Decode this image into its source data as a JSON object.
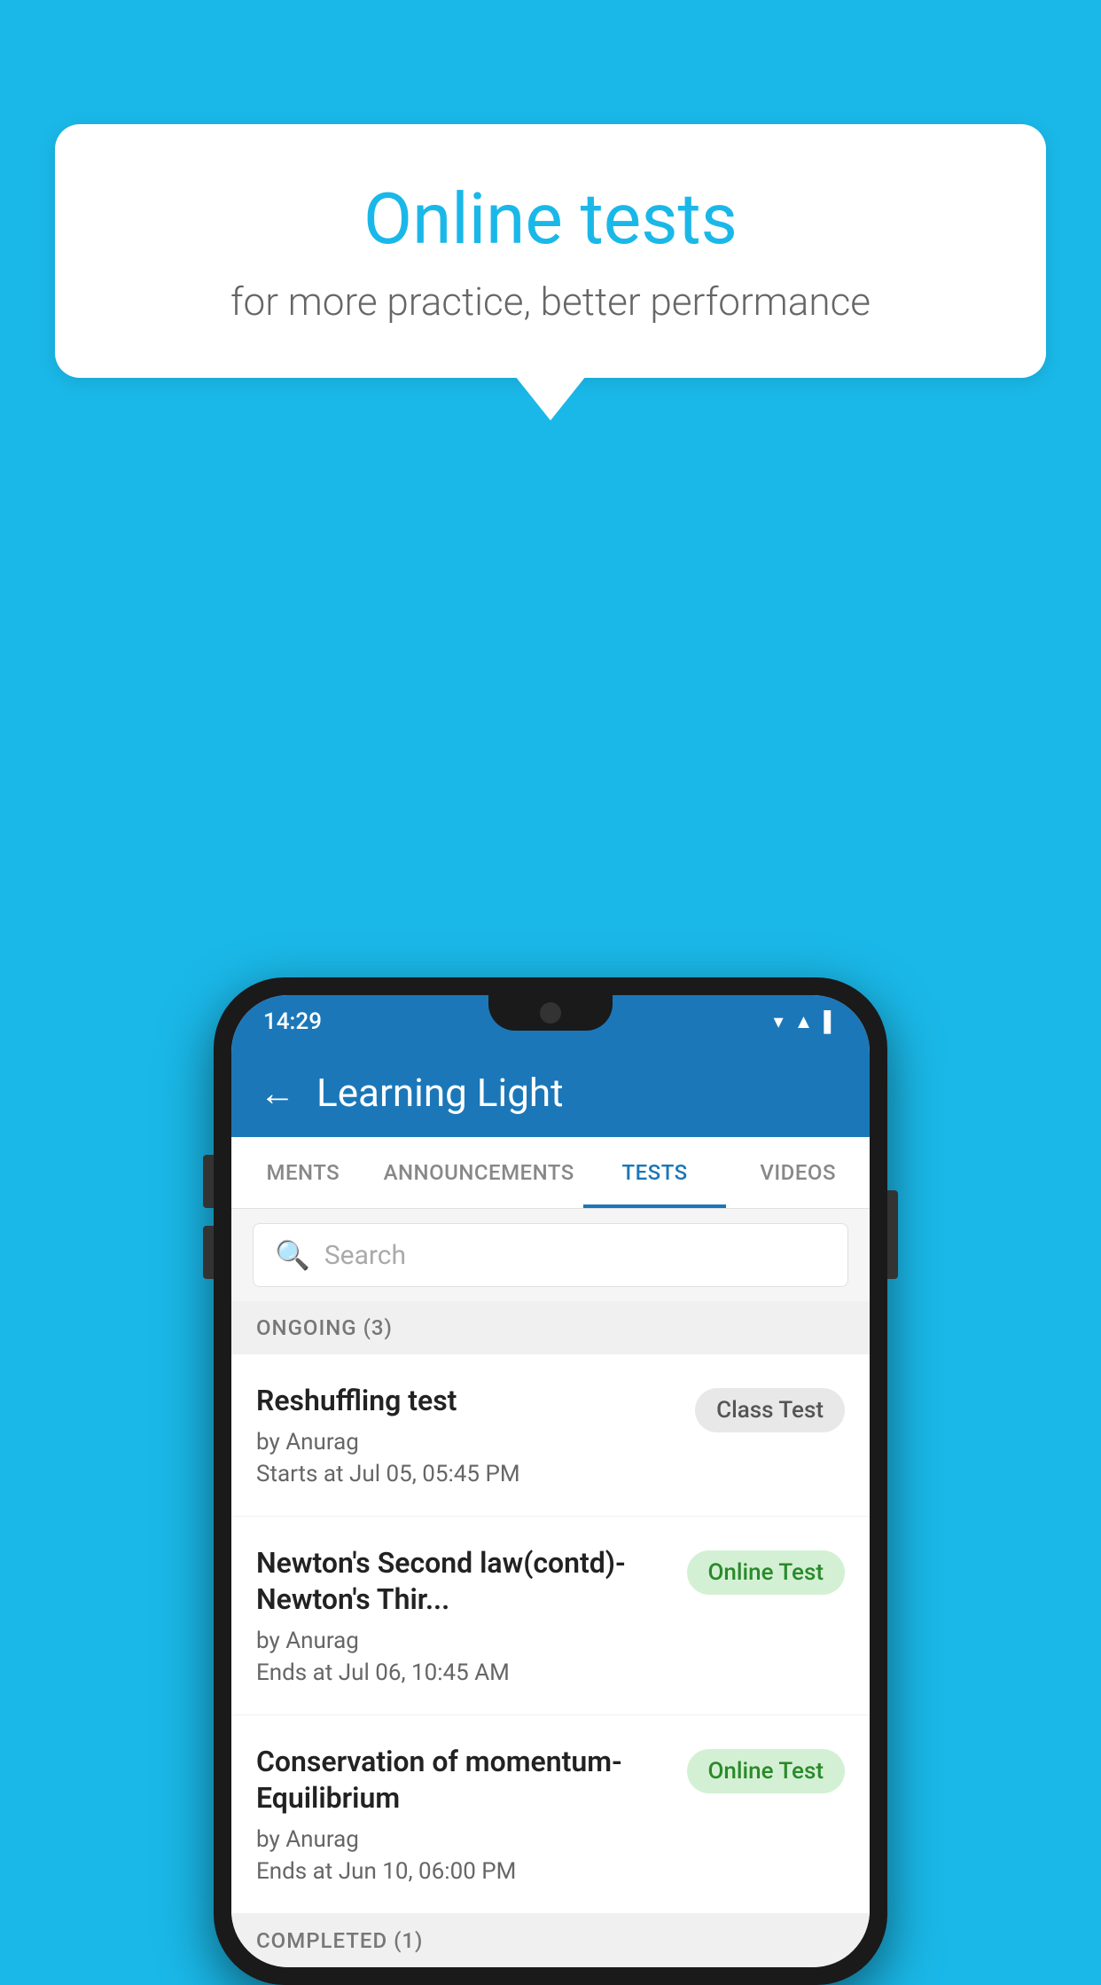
{
  "background": {
    "color": "#1ab8e8"
  },
  "speech_bubble": {
    "title": "Online tests",
    "subtitle": "for more practice, better performance"
  },
  "phone": {
    "status_bar": {
      "time": "14:29",
      "icons": [
        "wifi",
        "signal",
        "battery"
      ]
    },
    "header": {
      "back_label": "←",
      "title": "Learning Light"
    },
    "tabs": [
      {
        "label": "MENTS",
        "active": false
      },
      {
        "label": "ANNOUNCEMENTS",
        "active": false
      },
      {
        "label": "TESTS",
        "active": true
      },
      {
        "label": "VIDEOS",
        "active": false
      }
    ],
    "search": {
      "placeholder": "Search"
    },
    "sections": [
      {
        "title": "ONGOING (3)",
        "tests": [
          {
            "name": "Reshuffling test",
            "author": "by Anurag",
            "time_label": "Starts at",
            "time": "Jul 05, 05:45 PM",
            "badge": "Class Test",
            "badge_type": "class"
          },
          {
            "name": "Newton's Second law(contd)-Newton's Thir...",
            "author": "by Anurag",
            "time_label": "Ends at",
            "time": "Jul 06, 10:45 AM",
            "badge": "Online Test",
            "badge_type": "online"
          },
          {
            "name": "Conservation of momentum-Equilibrium",
            "author": "by Anurag",
            "time_label": "Ends at",
            "time": "Jun 10, 06:00 PM",
            "badge": "Online Test",
            "badge_type": "online"
          }
        ]
      }
    ],
    "completed_section": "COMPLETED (1)"
  }
}
